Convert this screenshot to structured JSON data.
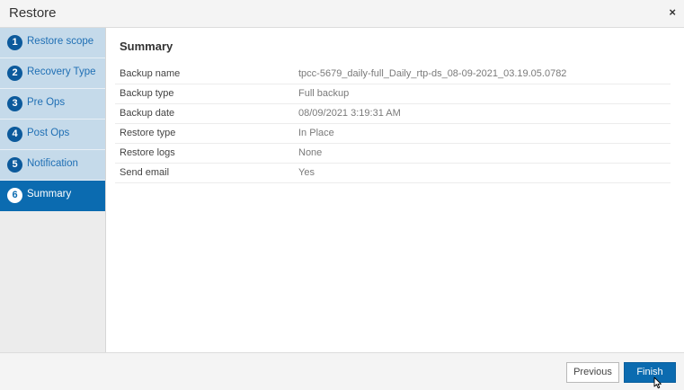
{
  "dialog": {
    "title": "Restore",
    "close_label": "×"
  },
  "steps": [
    {
      "number": "1",
      "label": "Restore scope"
    },
    {
      "number": "2",
      "label": "Recovery Type"
    },
    {
      "number": "3",
      "label": "Pre Ops"
    },
    {
      "number": "4",
      "label": "Post Ops"
    },
    {
      "number": "5",
      "label": "Notification"
    },
    {
      "number": "6",
      "label": "Summary"
    }
  ],
  "summary": {
    "title": "Summary",
    "rows": [
      {
        "key": "Backup name",
        "value": "tpcc-5679_daily-full_Daily_rtp-ds_08-09-2021_03.19.05.0782"
      },
      {
        "key": "Backup type",
        "value": "Full backup"
      },
      {
        "key": "Backup date",
        "value": "08/09/2021 3:19:31 AM"
      },
      {
        "key": "Restore type",
        "value": "In Place"
      },
      {
        "key": "Restore logs",
        "value": "None"
      },
      {
        "key": "Send email",
        "value": "Yes"
      }
    ]
  },
  "footer": {
    "previous_label": "Previous",
    "finish_label": "Finish"
  },
  "colors": {
    "accent": "#0b6bb0",
    "step_bg": "#c5daea",
    "step_text": "#1f6fb4"
  }
}
